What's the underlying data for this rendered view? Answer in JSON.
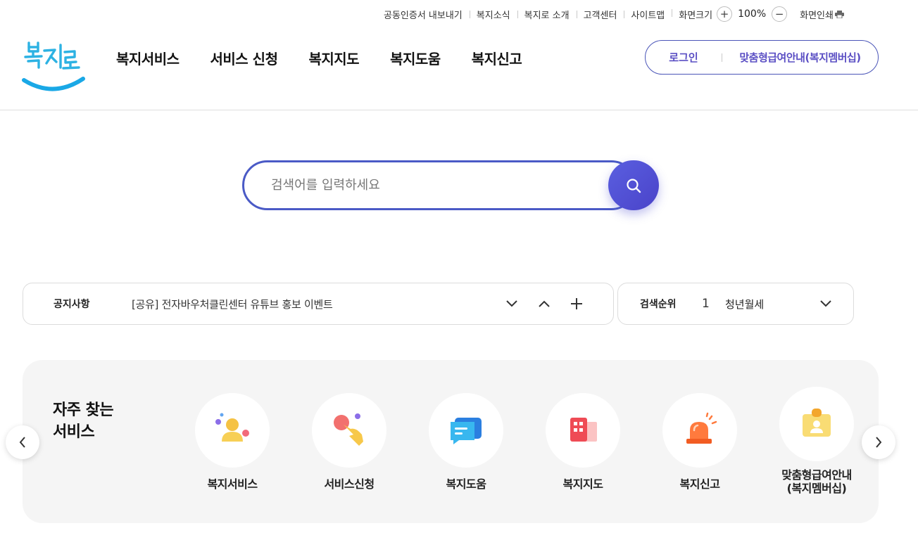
{
  "utility": {
    "links": [
      "공동인증서 내보내기",
      "복지소식",
      "복지로 소개",
      "고객센터",
      "사이트맵"
    ],
    "zoom_label": "화면크기",
    "zoom_in": "+",
    "zoom_value": "100%",
    "zoom_out": "−",
    "print_label": "화면인쇄"
  },
  "header": {
    "logo_text": "복지로",
    "menus": [
      "복지서비스",
      "서비스 신청",
      "복지지도",
      "복지도움",
      "복지신고"
    ],
    "login": "로그인",
    "membership": "맞춤형급여안내(복지멤버십)"
  },
  "search": {
    "placeholder": "검색어를 입력하세요"
  },
  "notice": {
    "label": "공지사항",
    "text": "[공유] 전자바우처클린센터 유튜브 홍보 이벤트"
  },
  "ranking": {
    "label": "검색순위",
    "rank": "1",
    "keyword": "청년월세"
  },
  "frequent": {
    "title_line1": "자주 찾는",
    "title_line2": "서비스",
    "items": [
      {
        "label": "복지서비스",
        "icon": "person-icon"
      },
      {
        "label": "서비스신청",
        "icon": "hand-pointer-icon"
      },
      {
        "label": "복지도움",
        "icon": "chat-bubble-icon"
      },
      {
        "label": "복지지도",
        "icon": "building-icon"
      },
      {
        "label": "복지신고",
        "icon": "siren-icon"
      },
      {
        "label_line1": "맞춤형급여안내",
        "label_line2": "(복지멤버십)",
        "icon": "id-badge-icon"
      }
    ]
  },
  "colors": {
    "accent": "#4a5ac6",
    "accent_text": "#5b4fc4",
    "panel_bg": "#f5f5f5"
  }
}
